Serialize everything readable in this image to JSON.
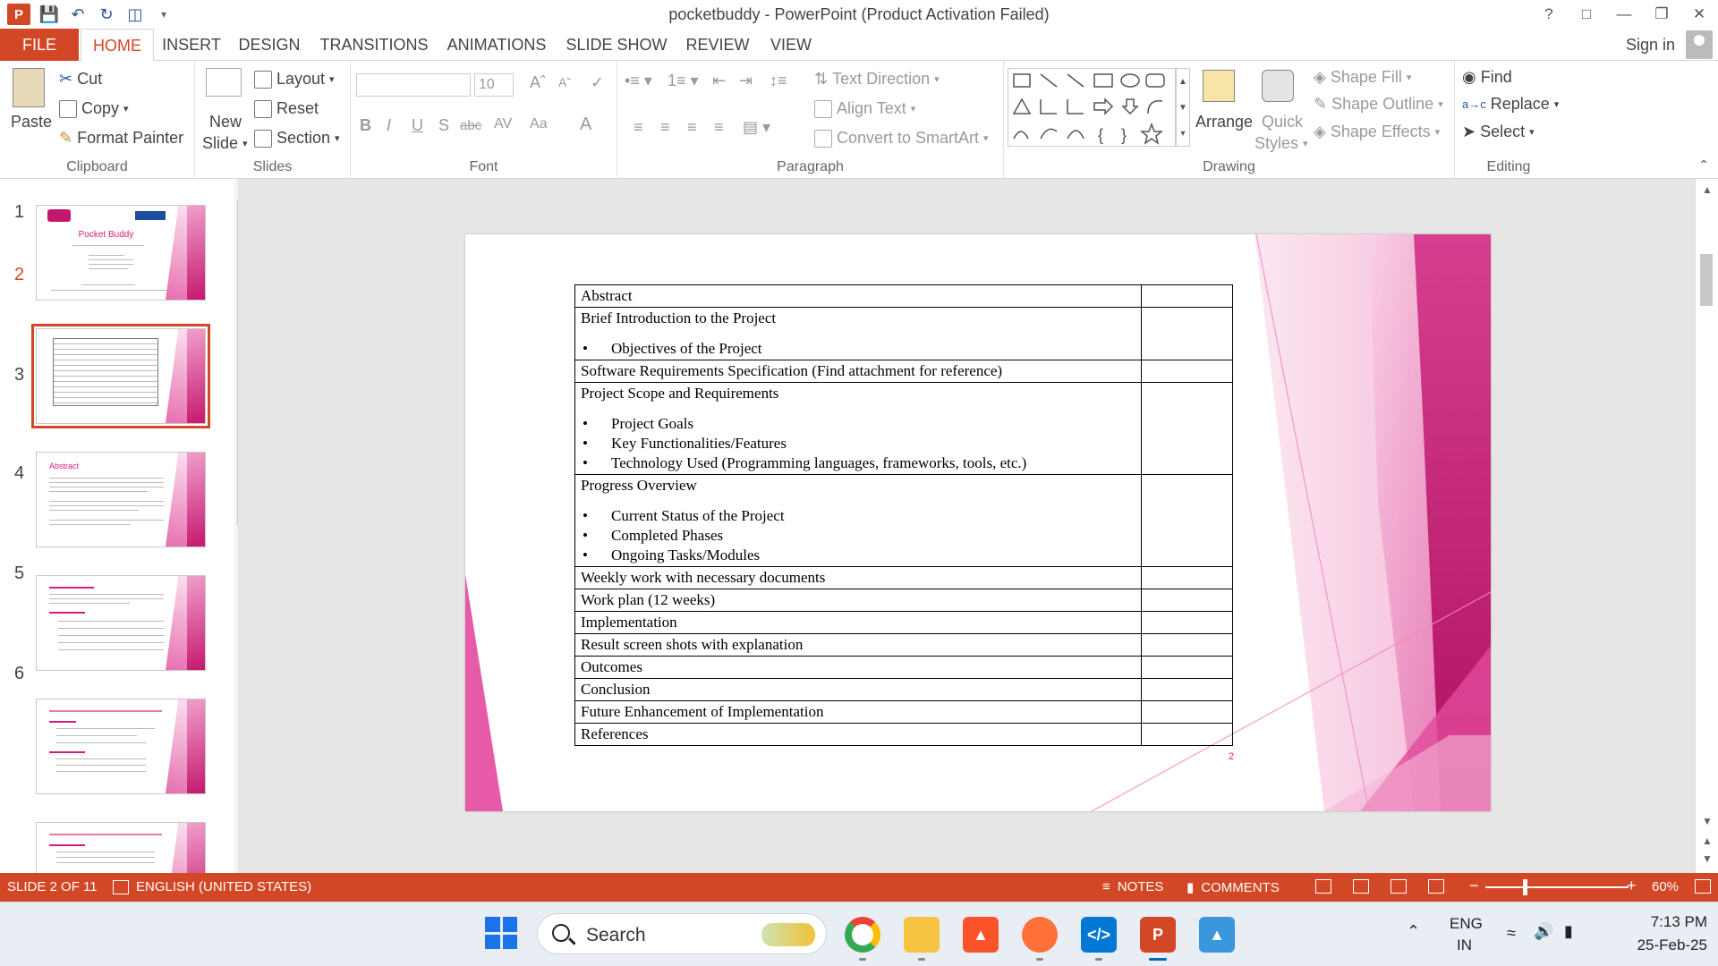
{
  "window": {
    "title": "pocketbuddy - PowerPoint (Product Activation Failed)",
    "help": "?",
    "sign_in": "Sign in"
  },
  "tabs": [
    "FILE",
    "HOME",
    "INSERT",
    "DESIGN",
    "TRANSITIONS",
    "ANIMATIONS",
    "SLIDE SHOW",
    "REVIEW",
    "VIEW"
  ],
  "ribbon": {
    "clipboard": {
      "label": "Clipboard",
      "paste": "Paste",
      "cut": "Cut",
      "copy": "Copy",
      "format_painter": "Format Painter"
    },
    "slides": {
      "label": "Slides",
      "new_slide_1": "New",
      "new_slide_2": "Slide",
      "layout": "Layout",
      "reset": "Reset",
      "section": "Section"
    },
    "font": {
      "label": "Font",
      "size": "10",
      "bold": "B",
      "italic": "I",
      "underline": "U",
      "shadow": "S",
      "strike": "abc",
      "spacing": "AV",
      "case": "Aa",
      "color": "A"
    },
    "paragraph": {
      "label": "Paragraph",
      "text_direction": "Text Direction",
      "align_text": "Align Text",
      "convert_smartart": "Convert to SmartArt"
    },
    "drawing": {
      "label": "Drawing",
      "arrange": "Arrange",
      "quick_styles_1": "Quick",
      "quick_styles_2": "Styles",
      "shape_fill": "Shape Fill",
      "shape_outline": "Shape Outline",
      "shape_effects": "Shape Effects"
    },
    "editing": {
      "label": "Editing",
      "find": "Find",
      "replace": "Replace",
      "select": "Select"
    }
  },
  "thumbnails": [
    {
      "num": "1",
      "title": "Pocket Buddy"
    },
    {
      "num": "2",
      "title": ""
    },
    {
      "num": "3",
      "title": "Abstract"
    },
    {
      "num": "4",
      "title": ""
    },
    {
      "num": "5",
      "title": ""
    },
    {
      "num": "6",
      "title": ""
    }
  ],
  "slide": {
    "page_number": "2",
    "rows": [
      {
        "text": "Abstract"
      },
      {
        "text": "Brief Introduction to the Project",
        "bullets": [
          "Objectives of the Project"
        ]
      },
      {
        "text": "Software Requirements Specification (Find attachment for reference)"
      },
      {
        "text": "Project Scope and Requirements",
        "bullets": [
          "Project Goals",
          "Key Functionalities/Features",
          "Technology Used (Programming languages, frameworks, tools, etc.)"
        ]
      },
      {
        "text": "Progress Overview",
        "bullets": [
          "Current Status of the Project",
          "Completed Phases",
          "Ongoing Tasks/Modules"
        ]
      },
      {
        "text": "Weekly work with necessary documents"
      },
      {
        "text": "Work plan (12 weeks)"
      },
      {
        "text": "Implementation"
      },
      {
        "text": "Result screen shots with explanation"
      },
      {
        "text": "Outcomes"
      },
      {
        "text": "Conclusion"
      },
      {
        "text": "Future Enhancement of Implementation"
      },
      {
        "text": "References"
      }
    ]
  },
  "status": {
    "slide_info": "SLIDE 2 OF 11",
    "language": "ENGLISH (UNITED STATES)",
    "notes": "NOTES",
    "comments": "COMMENTS",
    "zoom": "60%"
  },
  "taskbar": {
    "search": "Search",
    "lang_1": "ENG",
    "lang_2": "IN",
    "time": "7:13 PM",
    "date": "25-Feb-25"
  },
  "colors": {
    "accent": "#d24726",
    "slide_pink": "#d81b7a"
  }
}
